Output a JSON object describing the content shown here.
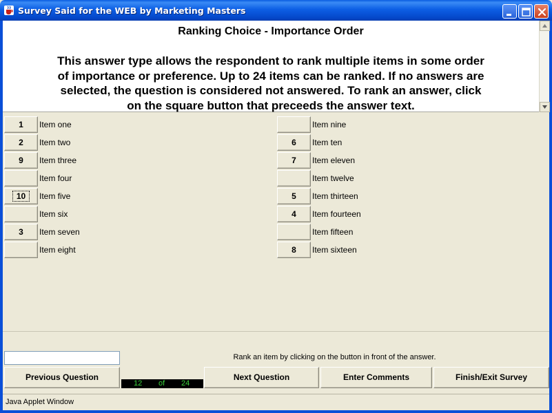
{
  "window": {
    "title": "Survey Said for the WEB by Marketing Masters",
    "app_icon": "java-cup-icon"
  },
  "question": {
    "title": "Ranking Choice - Importance Order",
    "description_lines": [
      "This answer type allows the respondent to rank multiple items in some order",
      "of importance or preference. Up to 24 items can be ranked. If no answers are",
      "selected, the question is considered not answered. To rank an answer, click",
      "on the square button that preceeds the answer text."
    ]
  },
  "items": [
    {
      "label": "Item one",
      "rank": "1"
    },
    {
      "label": "Item two",
      "rank": "2"
    },
    {
      "label": "Item three",
      "rank": "9"
    },
    {
      "label": "Item four",
      "rank": ""
    },
    {
      "label": "Item five",
      "rank": "10",
      "focused": true
    },
    {
      "label": "Item six",
      "rank": ""
    },
    {
      "label": "Item seven",
      "rank": "3"
    },
    {
      "label": "Item eight",
      "rank": ""
    },
    {
      "label": "Item nine",
      "rank": ""
    },
    {
      "label": "Item ten",
      "rank": "6"
    },
    {
      "label": "Item eleven",
      "rank": "7"
    },
    {
      "label": "Item twelve",
      "rank": ""
    },
    {
      "label": "Item thirteen",
      "rank": "5"
    },
    {
      "label": "Item fourteen",
      "rank": "4"
    },
    {
      "label": "Item fifteen",
      "rank": ""
    },
    {
      "label": "Item sixteen",
      "rank": "8"
    }
  ],
  "status": {
    "input_value": "",
    "message": "Rank an item by clicking on the button in front of the answer."
  },
  "progress": {
    "current": "12",
    "separator": "of",
    "total": "24"
  },
  "buttons": {
    "previous": "Previous Question",
    "next": "Next Question",
    "comments": "Enter Comments",
    "finish": "Finish/Exit Survey"
  },
  "applet_label": "Java Applet Window",
  "colors": {
    "titlebar": "#0A5DE0",
    "panel": "#ECE9D8",
    "progress_bg": "#000000",
    "progress_text": "#3CD23C"
  }
}
